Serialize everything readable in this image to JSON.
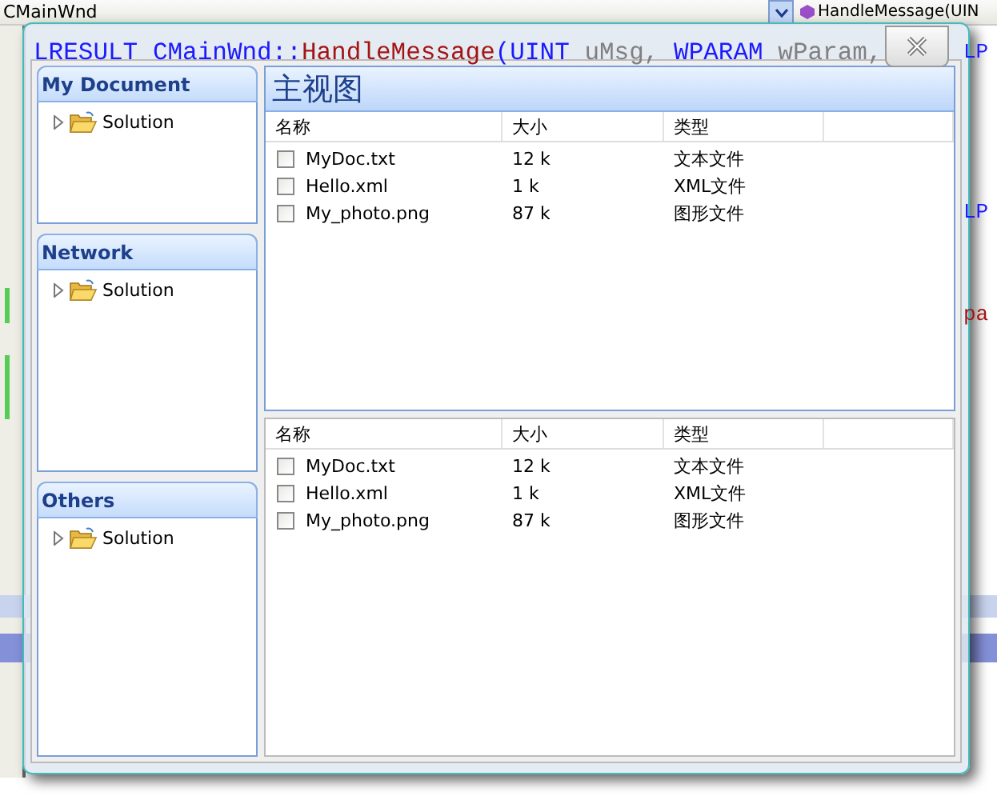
{
  "editor": {
    "class_combo": "CMainWnd",
    "method_combo": "HandleMessage(UIN",
    "code_line": [
      {
        "text": "LRESULT",
        "kind": "keyword"
      },
      {
        "text": "CMainWnd::",
        "kind": "keyword"
      },
      {
        "text": "HandleMessage",
        "kind": "function"
      },
      {
        "text": "(UINT",
        "kind": "keyword"
      },
      {
        "text": "uMsg,",
        "kind": "param"
      },
      {
        "text": "WPARAM",
        "kind": "keyword"
      },
      {
        "text": "wParam,",
        "kind": "param"
      }
    ],
    "side_fragments": [
      {
        "text": "LP",
        "kind": "keyword"
      },
      {
        "text": "LP",
        "kind": "keyword"
      },
      {
        "text": "pa",
        "kind": "function"
      }
    ]
  },
  "dialog": {
    "panels": [
      {
        "title": "My Document",
        "items": [
          {
            "label": "Solution",
            "expanded": false
          }
        ]
      },
      {
        "title": "Network",
        "items": [
          {
            "label": "Solution",
            "expanded": false
          }
        ]
      },
      {
        "title": "Others",
        "items": [
          {
            "label": "Solution",
            "expanded": false
          }
        ]
      }
    ],
    "main_view": {
      "title": "主视图",
      "columns": [
        "名称",
        "大小",
        "类型"
      ],
      "rows": [
        {
          "name": "MyDoc.txt",
          "size": "12 k",
          "type": "文本文件",
          "checked": false
        },
        {
          "name": "Hello.xml",
          "size": "1 k",
          "type": "XML文件",
          "checked": false
        },
        {
          "name": "My_photo.png",
          "size": "87 k",
          "type": "图形文件",
          "checked": false
        }
      ]
    },
    "bottom_list": {
      "columns": [
        "名称",
        "大小",
        "类型"
      ],
      "rows": [
        {
          "name": "MyDoc.txt",
          "size": "12 k",
          "type": "文本文件",
          "checked": false
        },
        {
          "name": "Hello.xml",
          "size": "1 k",
          "type": "XML文件",
          "checked": false
        },
        {
          "name": "My_photo.png",
          "size": "87 k",
          "type": "图形文件",
          "checked": false
        }
      ]
    }
  }
}
